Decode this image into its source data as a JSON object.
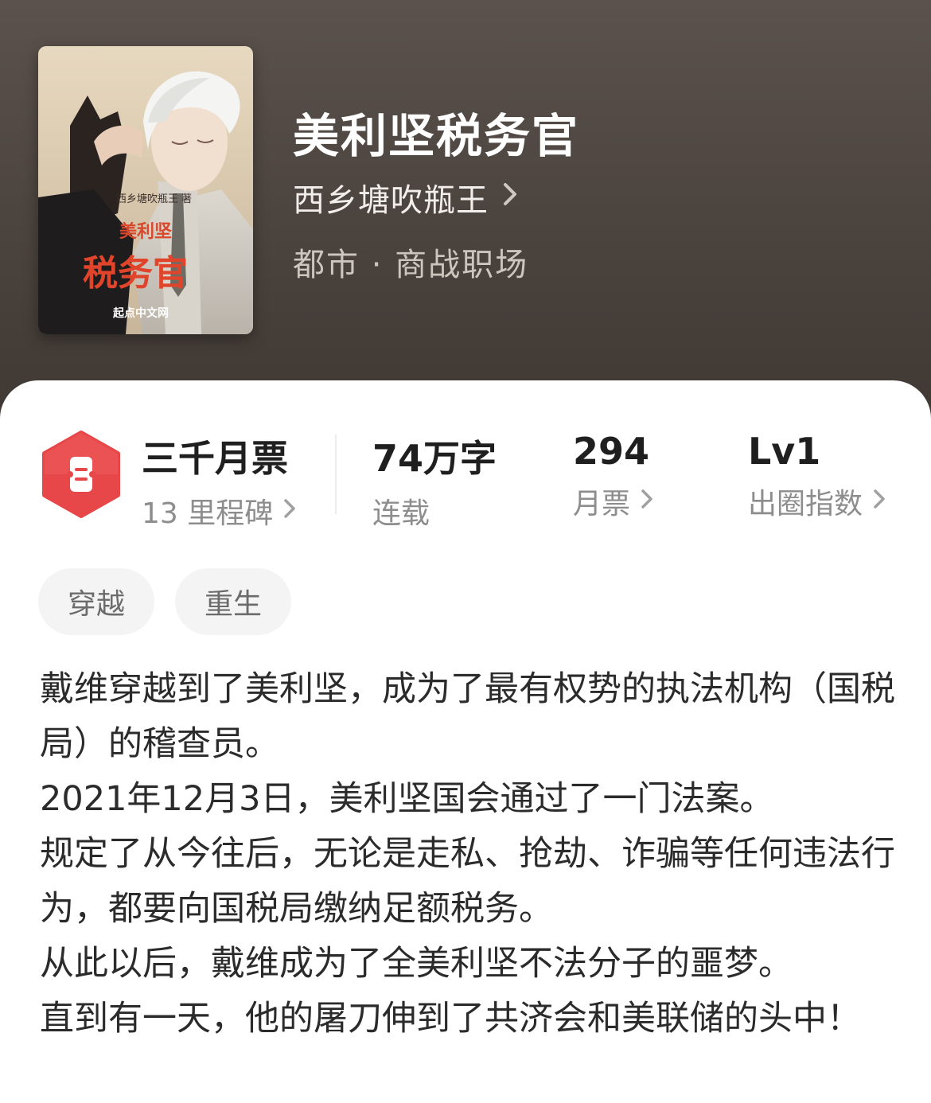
{
  "book": {
    "title": "美利坚税务官",
    "author": "西乡塘吹瓶王",
    "genre": "都市 · 商战职场",
    "cover": {
      "author_text": "西乡塘吹瓶王 著",
      "title_line1": "美利坚",
      "title_line2": "税务官",
      "publisher": "起点中文网"
    }
  },
  "stats": {
    "milestone": {
      "value": "三千月票",
      "label": "13 里程碑"
    },
    "words": {
      "value": "74万字",
      "label": "连载"
    },
    "tickets": {
      "value": "294",
      "label": "月票"
    },
    "index": {
      "value": "Lv1",
      "label": "出圈指数"
    }
  },
  "tags": [
    "穿越",
    "重生"
  ],
  "synopsis": [
    "戴维穿越到了美利坚，成为了最有权势的执法机构（国税局）的稽查员。",
    "2021年12月3日，美利坚国会通过了一门法案。",
    "规定了从今往后，无论是走私、抢劫、诈骗等任何违法行为，都要向国税局缴纳足额税务。",
    "从此以后，戴维成为了全美利坚不法分子的噩梦。",
    "直到有一天，他的屠刀伸到了共济会和美联储的头中！"
  ],
  "icons": {
    "milestone": "ticket-icon",
    "chevron": "chevron-right-icon"
  },
  "colors": {
    "header_bg": "#4d4540",
    "ticket_red": "#e8474a"
  }
}
